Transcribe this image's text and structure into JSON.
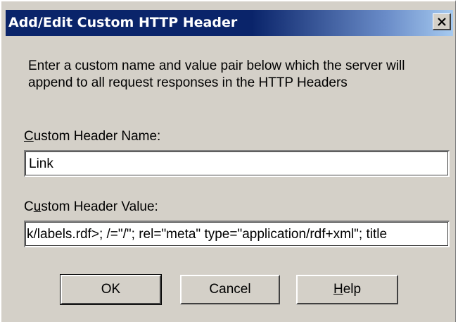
{
  "dialog": {
    "title": "Add/Edit Custom HTTP Header",
    "description": "Enter a custom name and value pair below which the server will append to all request responses in the HTTP Headers",
    "name_label_accel": "C",
    "name_label_rest": "ustom Header Name:",
    "name_value": "Link",
    "value_label_pre": "C",
    "value_label_accel": "u",
    "value_label_rest": "stom Header Value:",
    "value_value": "k/labels.rdf>; /=\"/\"; rel=\"meta\" type=\"application/rdf+xml\"; title",
    "ok_label": "OK",
    "cancel_label": "Cancel",
    "help_label_accel": "H",
    "help_label_rest": "elp",
    "close_icon": "close-icon"
  }
}
